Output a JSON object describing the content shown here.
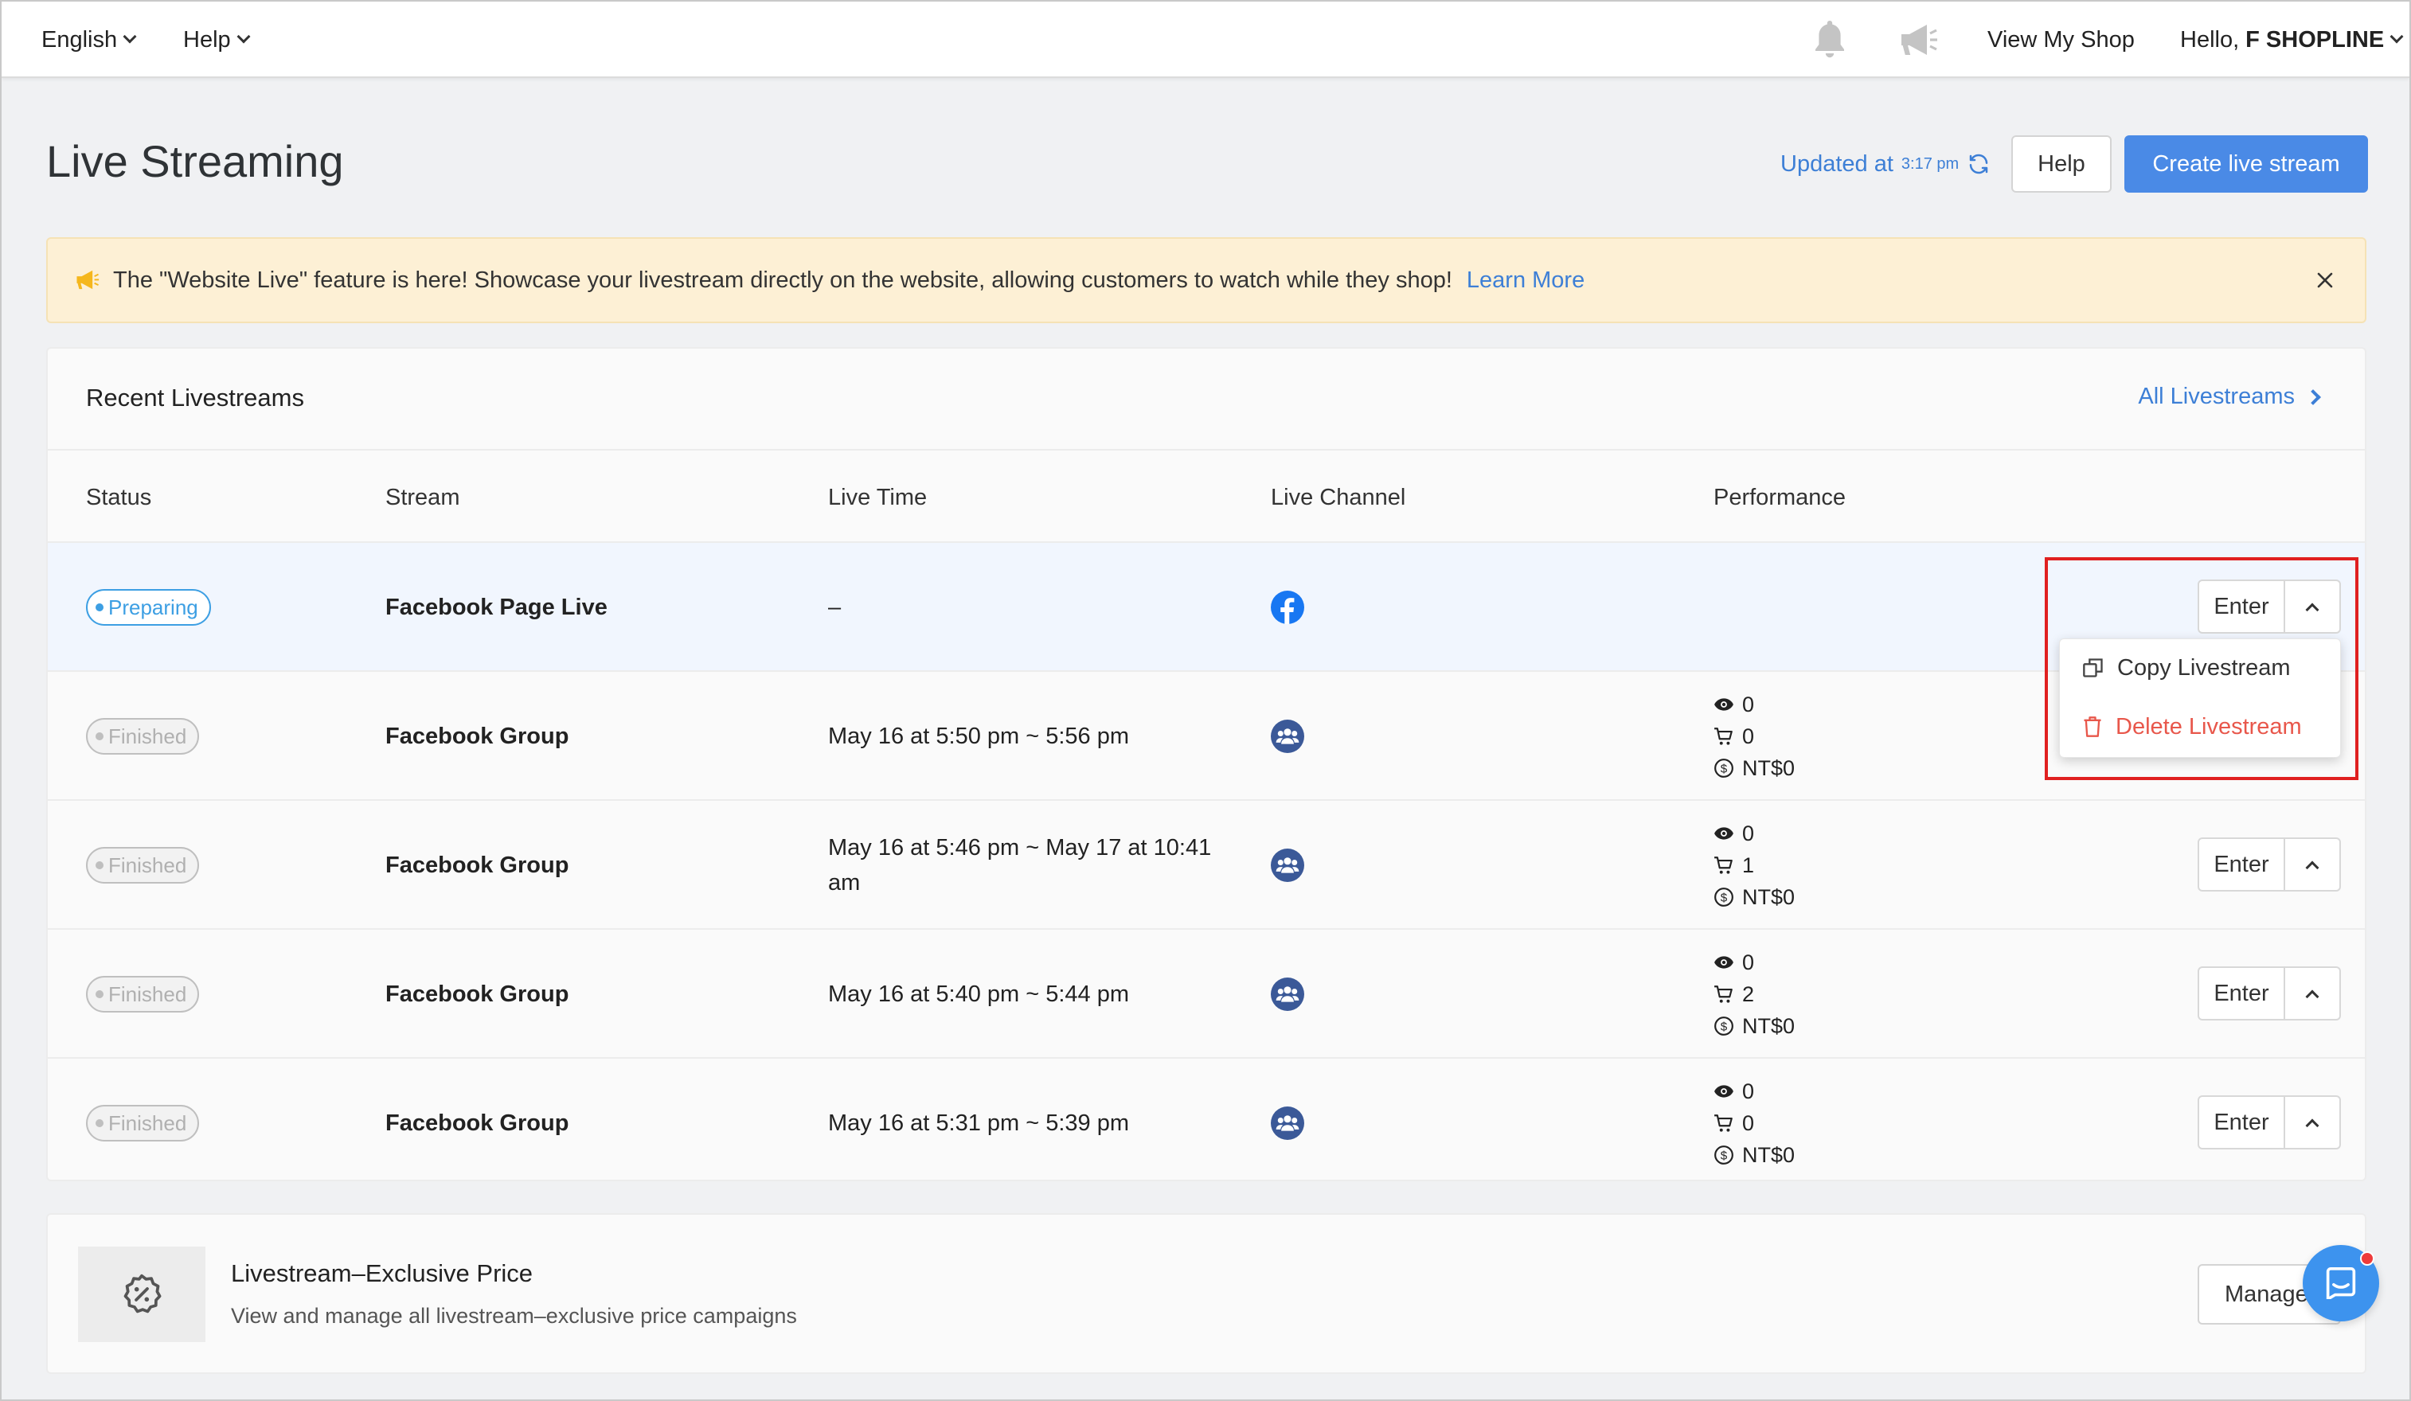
{
  "topbar": {
    "language": "English",
    "help": "Help",
    "view_shop": "View My Shop",
    "hello": "Hello,",
    "shop_name": "F SHOPLINE"
  },
  "header": {
    "title": "Live Streaming",
    "updated_label": "Updated at",
    "updated_time": "3:17 pm",
    "help_button": "Help",
    "create_button": "Create live stream"
  },
  "banner": {
    "text": "The \"Website Live\" feature is here! Showcase your livestream directly on the website, allowing customers to watch while they shop!",
    "link": "Learn More"
  },
  "recent": {
    "title": "Recent Livestreams",
    "all_link": "All Livestreams",
    "columns": [
      "Status",
      "Stream",
      "Live Time",
      "Live Channel",
      "Performance"
    ],
    "rows": [
      {
        "status": "Preparing",
        "stream": "Facebook Page Live",
        "time": "–",
        "channel": "facebook-page",
        "views": "",
        "carts": "",
        "sales": "",
        "enter": "Enter"
      },
      {
        "status": "Finished",
        "stream": "Facebook Group",
        "time": "May 16 at 5:50 pm ~ 5:56 pm",
        "channel": "facebook-group",
        "views": "0",
        "carts": "0",
        "sales": "NT$0",
        "enter": "Enter"
      },
      {
        "status": "Finished",
        "stream": "Facebook Group",
        "time": "May 16 at 5:46 pm ~ May 17 at 10:41 am",
        "channel": "facebook-group",
        "views": "0",
        "carts": "1",
        "sales": "NT$0",
        "enter": "Enter"
      },
      {
        "status": "Finished",
        "stream": "Facebook Group",
        "time": "May 16 at 5:40 pm ~ 5:44 pm",
        "channel": "facebook-group",
        "views": "0",
        "carts": "2",
        "sales": "NT$0",
        "enter": "Enter"
      },
      {
        "status": "Finished",
        "stream": "Facebook Group",
        "time": "May 16 at 5:31 pm ~ 5:39 pm",
        "channel": "facebook-group",
        "views": "0",
        "carts": "0",
        "sales": "NT$0",
        "enter": "Enter"
      }
    ],
    "dropdown": {
      "copy": "Copy Livestream",
      "delete": "Delete Livestream"
    }
  },
  "price_card": {
    "title": "Livestream–Exclusive Price",
    "description": "View and manage all livestream–exclusive price campaigns",
    "button": "Manage"
  },
  "colors": {
    "accent": "#4a8ae6",
    "link": "#3d7fd6",
    "danger": "#e8574b",
    "banner_bg": "#fdf0d5"
  }
}
